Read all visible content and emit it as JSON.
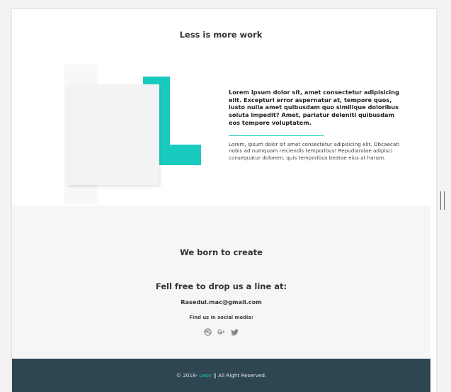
{
  "about": {
    "title": "Less is more work",
    "lead": "Lorem ipsum dolor sit, amet consectetur adipisicing elit. Excepturi error aspernatur at, tempore quos, iusto nulla amet quibusdam quo similique doloribus soluta impedit? Amet, pariatur deleniti quibusdam eos tempore voluptatem.",
    "body": "Lorem, ipsum dolor sit amet consectetur adipisicing elit. Obcaecati nobis ad numquam reiciendis temporibus! Repudiandae adipisci consequatur dolorem, quis temporibus beatae eius at harum."
  },
  "contact": {
    "tagline": "We born to create",
    "heading": "Fell free to drop us a line at:",
    "email": "Rasedul.mac@gmail.com",
    "social_label": "Find us in social media:",
    "social_icons": [
      "dribbble-icon",
      "google-plus-icon",
      "twitter-icon"
    ]
  },
  "footer": {
    "prefix": "© 2018-",
    "author": "Leon",
    "suffix": "|| All Right Reserved."
  },
  "colors": {
    "accent": "#19cbbf",
    "footer_bg": "#2e4552"
  }
}
